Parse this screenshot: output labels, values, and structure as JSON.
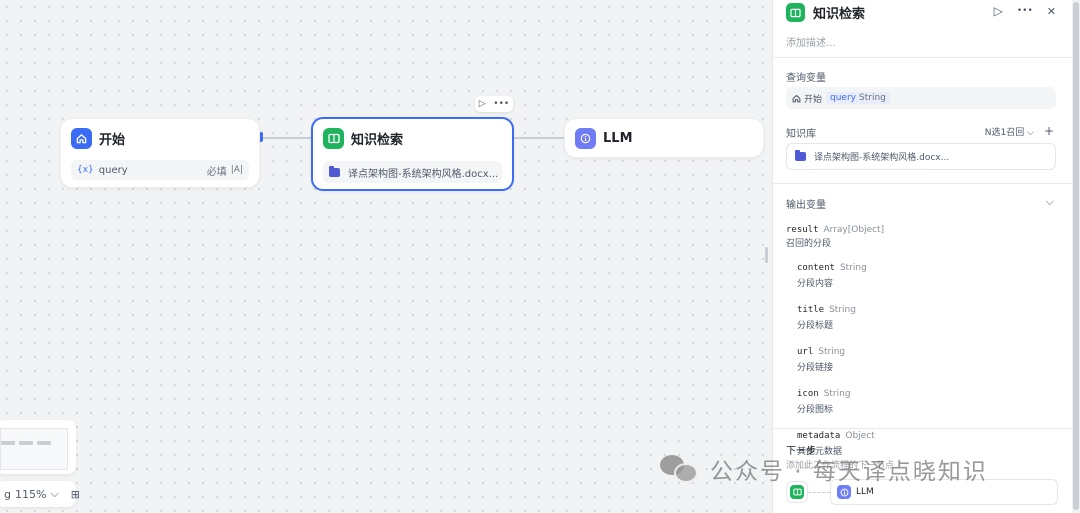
{
  "canvas": {
    "start_node": {
      "title": "开始",
      "icon": "home-icon",
      "param": {
        "icon_text": "{x}",
        "name": "query",
        "required": "必填",
        "type_badge": "|A|"
      }
    },
    "kb_node": {
      "title": "知识检索",
      "icon": "book-icon",
      "file": "译点架构图-系统架构风格.docx..."
    },
    "llm_node": {
      "title": "LLM",
      "icon": "info-icon"
    },
    "node_toolbar": {
      "run": "▷",
      "more": "•••"
    },
    "zoom": {
      "value": "115%",
      "prefix": "g",
      "chevron": "⌵",
      "fit": "⊞"
    }
  },
  "panel": {
    "title": "知识检索",
    "actions": {
      "run": "▷",
      "more": "•••",
      "close": "✕"
    },
    "description_placeholder": "添加描述...",
    "query_section": {
      "label": "查询变量",
      "source_node": "开始",
      "variable": "query",
      "variable_type": "String"
    },
    "kb_section": {
      "label": "知识库",
      "recall_mode": "N选1召回",
      "add": "+",
      "file": "译点架构图-系统架构风格.docx..."
    },
    "output_section": {
      "label": "输出变量",
      "root": {
        "name": "result",
        "type": "Array[Object]",
        "desc": "召回的分段"
      },
      "fields": [
        {
          "name": "content",
          "type": "String",
          "desc": "分段内容"
        },
        {
          "name": "title",
          "type": "String",
          "desc": "分段标题"
        },
        {
          "name": "url",
          "type": "String",
          "desc": "分段链接"
        },
        {
          "name": "icon",
          "type": "String",
          "desc": "分段图标"
        },
        {
          "name": "metadata",
          "type": "Object",
          "desc": "其他元数据"
        }
      ]
    },
    "next_step": {
      "label": "下一步",
      "desc": "添加此工作流程的下一节点",
      "target": "LLM"
    }
  },
  "watermark": {
    "text": "公众号 · 每天译点晓知识"
  },
  "colors": {
    "accent": "#3b6cf6",
    "kb_green": "#1fb35e",
    "llm_violet": "#6f7cf5"
  }
}
